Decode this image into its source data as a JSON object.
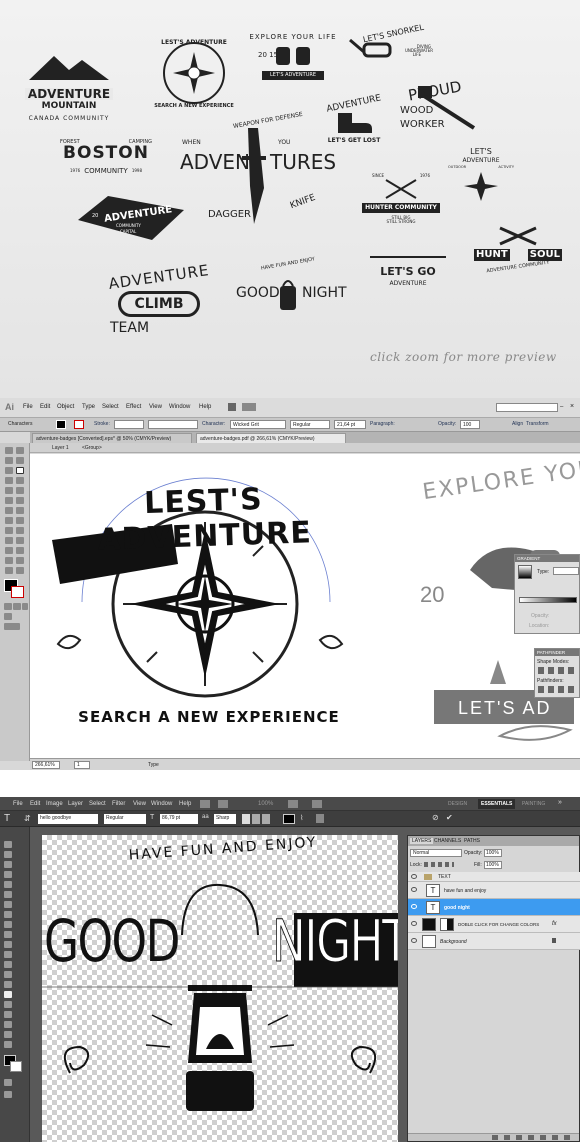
{
  "preview": {
    "badges": [
      {
        "lines": [
          "ADVENTURE",
          "MOUNTAIN",
          "CANADA COMMUNITY"
        ]
      },
      {
        "lines": [
          "LEST'S ADVENTURE",
          "SEARCH A NEW EXPERIENCE"
        ]
      },
      {
        "lines": [
          "EXPLORE YOUR LIFE",
          "20 15",
          "LET'S ADVENTURE"
        ]
      },
      {
        "lines": [
          "LET'S SNORKEL",
          "DIVING",
          "UNDERWATER",
          "LIFE"
        ]
      },
      {
        "lines": [
          "FOREST",
          "CAMPING",
          "BOSTON",
          "COMMUNITY",
          "1976",
          "1998"
        ]
      },
      {
        "lines": [
          "WEAPON FOR DEFENSE",
          "WHEN",
          "YOU",
          "ADVEN",
          "TURES",
          "DAGGER",
          "KNIFE"
        ]
      },
      {
        "lines": [
          "ADVENTURE",
          "LET'S GET LOST"
        ]
      },
      {
        "lines": [
          "PROUD",
          "WOOD",
          "WORKER"
        ]
      },
      {
        "lines": [
          "LET'S",
          "ADVENTURE",
          "OUTDOOR",
          "ACTIVITY"
        ]
      },
      {
        "lines": [
          "ADVENTURE",
          "20",
          "21",
          "COMMUNITY",
          "CAPITAL"
        ]
      },
      {
        "lines": [
          "SINCE",
          "1976",
          "HUNTER COMMUNITY",
          "STILL BIG",
          "STILL STRONG"
        ]
      },
      {
        "lines": [
          "LET'S GO",
          "ADVENTURE"
        ]
      },
      {
        "lines": [
          "HUNT",
          "SOUL",
          "ADVENTURE COMMUNITY"
        ]
      },
      {
        "lines": [
          "ADVENTURE",
          "CLIMB",
          "TEAM"
        ]
      },
      {
        "lines": [
          "HAVE FUN AND ENJOY",
          "GOOD",
          "NIGHT"
        ]
      }
    ],
    "caption": "click zoom for more preview"
  },
  "illustrator": {
    "logo": "Ai",
    "menu": [
      "File",
      "Edit",
      "Object",
      "Type",
      "Select",
      "Effect",
      "View",
      "Window",
      "Help"
    ],
    "control": {
      "label": "Characters",
      "stroke_label": "Stroke:",
      "character_label": "Character:",
      "font": "Wicked Grit",
      "style": "Regular",
      "size": "21,64 pt",
      "paragraph_label": "Paragraph:",
      "opacity_label": "Opacity:",
      "opacity": "100",
      "align_label": "Align",
      "transform_label": "Transform"
    },
    "tabs": [
      {
        "label": "adventure-badges [Converted].eps* @ 50% (CMYK/Preview)",
        "active": false
      },
      {
        "label": "adventure-badges.pdf @ 266,61% (CMYK/Preview)",
        "active": true
      }
    ],
    "breadcrumb": [
      "Layer 1",
      "<Group>"
    ],
    "artwork": {
      "main_top": "LEST'S ADVENTURE",
      "main_bottom": "SEARCH A NEW EXPERIENCE",
      "side_top": "EXPLORE YOU",
      "side_year": "20",
      "side_ribbon": "LET'S AD"
    },
    "gradient_panel": {
      "title": "GRADIENT",
      "type_label": "Type:",
      "opacity_label": "Opacity:",
      "location_label": "Location:"
    },
    "pathfinder_panel": {
      "title": "PATHFINDER",
      "shape_modes": "Shape Modes:",
      "pathfinders": "Pathfinders:"
    },
    "status": {
      "zoom": "266,61%",
      "page": "1",
      "mode": "Type"
    }
  },
  "photoshop": {
    "menu": [
      "File",
      "Edit",
      "Image",
      "Layer",
      "Select",
      "Filter",
      "View",
      "Window",
      "Help"
    ],
    "zoom": "100%",
    "workspaces": [
      "DESIGN",
      "ESSENTIALS",
      "PAINTING"
    ],
    "active_workspace": "ESSENTIALS",
    "options": {
      "text": "hello goodbye",
      "style": "Regular",
      "size": "86,79 pt",
      "aa": "Sharp"
    },
    "artwork": {
      "arc": "HAVE FUN AND ENJOY",
      "left": "GOOD",
      "right": "NIGHT"
    },
    "layers_panel": {
      "tabs": [
        "LAYERS",
        "CHANNELS",
        "PATHS"
      ],
      "blend": "Normal",
      "opacity_label": "Opacity:",
      "opacity": "100%",
      "lock_label": "Lock:",
      "fill_label": "Fill:",
      "fill": "100%",
      "layers": [
        {
          "name": "TEXT",
          "kind": "group",
          "selected": false
        },
        {
          "name": "have fun and enjoy",
          "kind": "text",
          "selected": false
        },
        {
          "name": "good   night",
          "kind": "text",
          "selected": true
        },
        {
          "name": "DOBLE CLICK FOR CHANGE COLORS",
          "kind": "fx",
          "selected": false
        },
        {
          "name": "Background",
          "kind": "bg",
          "selected": false
        }
      ]
    }
  }
}
